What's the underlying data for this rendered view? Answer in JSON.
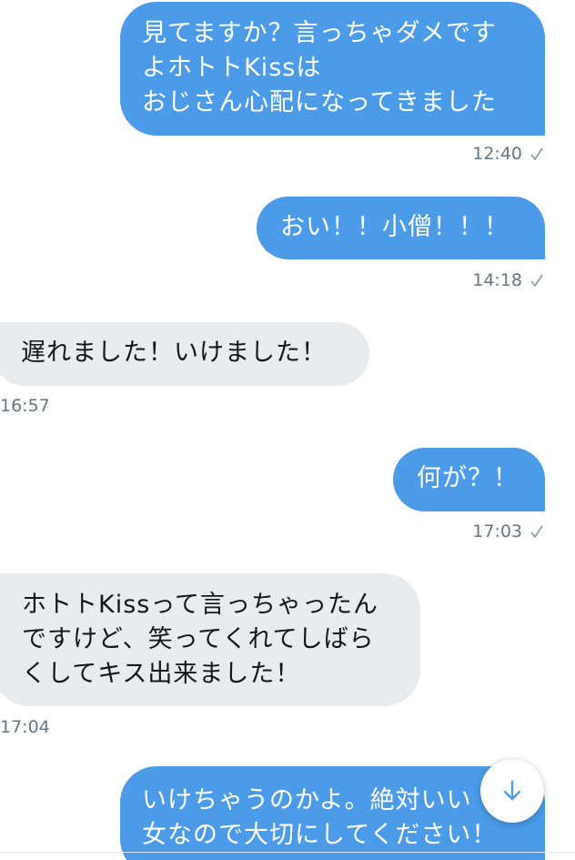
{
  "messages": [
    {
      "direction": "sent",
      "text": "見てますか？言っちゃダメです\nよホトトKissは\nおじさん心配になってきました",
      "time": "12:40"
    },
    {
      "direction": "sent",
      "text": "おい！！小僧！！！",
      "time": "14:18"
    },
    {
      "direction": "received",
      "text": "遅れました！いけました！",
      "time": "16:57"
    },
    {
      "direction": "sent",
      "text": "何が？！",
      "time": "17:03"
    },
    {
      "direction": "received",
      "text": "ホトトKissって言っちゃったん\nですけど、笑ってくれてしばら\nくしてキス出来ました！",
      "time": "17:04"
    },
    {
      "direction": "sent",
      "text": "いけちゃうのかよ。絶対いい\n女なので大切にしてください！",
      "time": ""
    }
  ],
  "colors": {
    "sent_bubble": "#4b9be8",
    "received_bubble": "#e9ecef",
    "timestamp": "#657786",
    "scroll_button_icon": "#4b9be8"
  },
  "icons": {
    "read_receipt": "checkmark-icon",
    "scroll_down": "arrow-down-icon"
  }
}
